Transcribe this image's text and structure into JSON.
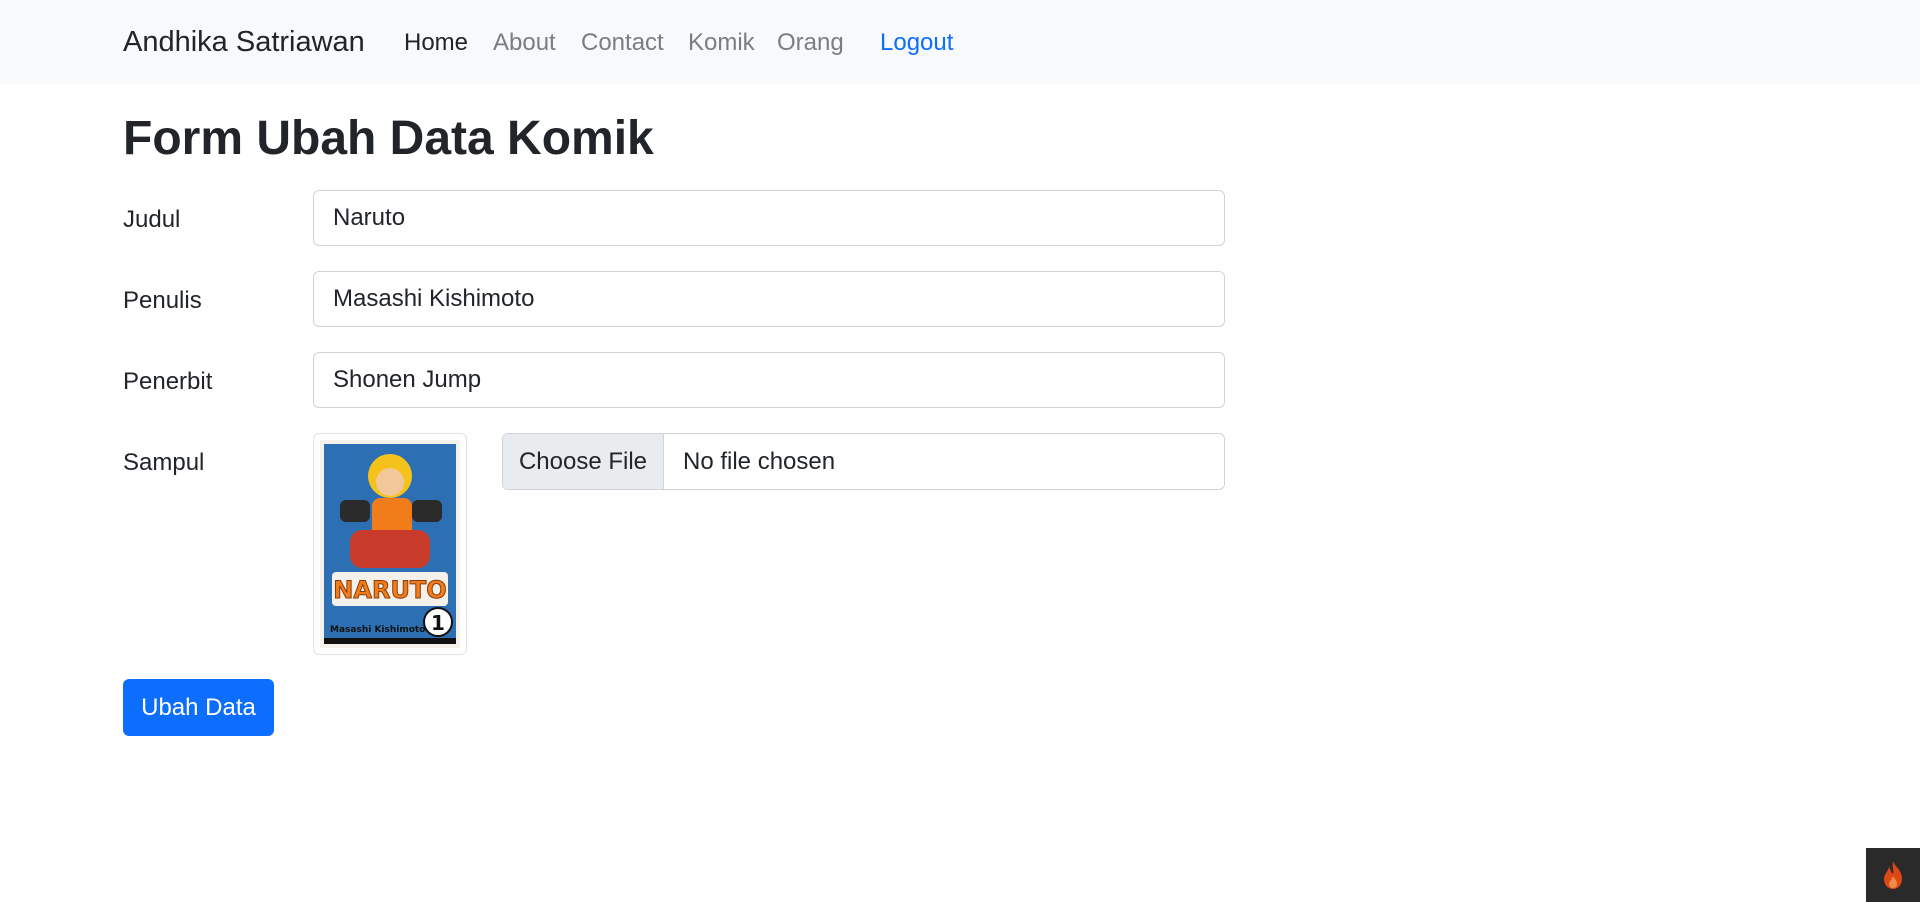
{
  "navbar": {
    "brand": "Andhika Satriawan",
    "links": [
      {
        "label": "Home",
        "active": true
      },
      {
        "label": "About",
        "active": false
      },
      {
        "label": "Contact",
        "active": false
      },
      {
        "label": "Komik",
        "active": false
      },
      {
        "label": "Orang",
        "active": false
      }
    ],
    "logout": "Logout"
  },
  "page": {
    "title": "Form Ubah Data Komik"
  },
  "form": {
    "judul": {
      "label": "Judul",
      "value": "Naruto"
    },
    "penulis": {
      "label": "Penulis",
      "value": "Masashi Kishimoto"
    },
    "penerbit": {
      "label": "Penerbit",
      "value": "Shonen Jump"
    },
    "sampul": {
      "label": "Sampul",
      "choose_label": "Choose File",
      "status": "No file chosen",
      "cover_title": "NARUTO",
      "cover_author": "Masashi Kishimoto",
      "cover_volume": "1"
    },
    "submit": "Ubah Data"
  },
  "colors": {
    "primary": "#0d6efd",
    "navbar_bg": "#f8f9fa",
    "debug_flame": "#dd4814"
  },
  "icons": {
    "debug_toolbar": "flame-icon"
  }
}
